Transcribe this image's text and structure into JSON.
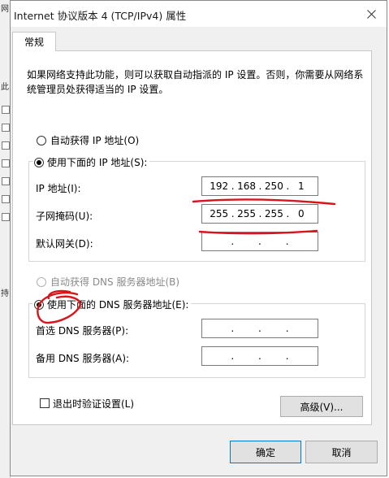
{
  "background_window": {
    "fragments": [
      "网",
      "此",
      "持"
    ]
  },
  "dialog": {
    "title": "Internet 协议版本 4 (TCP/IPv4) 属性",
    "close_icon": "close-icon"
  },
  "tabs": [
    {
      "label": "常规",
      "active": true
    }
  ],
  "description": "如果网络支持此功能，则可以获取自动指派的 IP 设置。否则，你需要从网络系统管理员处获得适当的 IP 设置。",
  "ip": {
    "auto_label": "自动获得 IP 地址(O)",
    "auto_selected": false,
    "manual_label": "使用下面的 IP 地址(S):",
    "manual_selected": true,
    "fields": [
      {
        "label": "IP 地址(I):",
        "octets": [
          "192",
          "168",
          "250",
          "1"
        ]
      },
      {
        "label": "子网掩码(U):",
        "octets": [
          "255",
          "255",
          "255",
          "0"
        ]
      },
      {
        "label": "默认网关(D):",
        "octets": [
          "",
          "",
          "",
          ""
        ]
      }
    ]
  },
  "dns": {
    "auto_label": "自动获得 DNS 服务器地址(B)",
    "auto_selected": false,
    "auto_disabled": true,
    "manual_label": "使用下面的 DNS 服务器地址(E):",
    "manual_selected": true,
    "fields": [
      {
        "label": "首选 DNS 服务器(P):",
        "octets": [
          "",
          "",
          "",
          ""
        ]
      },
      {
        "label": "备用 DNS 服务器(A):",
        "octets": [
          "",
          "",
          "",
          ""
        ]
      }
    ]
  },
  "validate_on_exit": {
    "label": "退出时验证设置(L)",
    "checked": false
  },
  "buttons": {
    "advanced": "高级(V)...",
    "ok": "确定",
    "cancel": "取消"
  },
  "colors": {
    "annotation_red": "#d8151b",
    "primary_border": "#0078d7"
  }
}
